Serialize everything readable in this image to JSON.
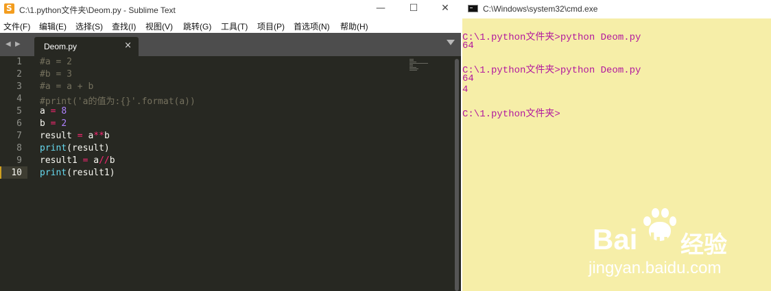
{
  "sublime": {
    "title": "C:\\1.python文件夹\\Deom.py - Sublime Text",
    "window_controls": {
      "minimize": "—",
      "maximize": "☐",
      "close": "✕"
    },
    "menu": [
      "文件(F)",
      "编辑(E)",
      "选择(S)",
      "查找(I)",
      "视图(V)",
      "跳转(G)",
      "工具(T)",
      "项目(P)",
      "首选项(N)",
      "帮助(H)"
    ],
    "tab": {
      "label": "Deom.py",
      "close": "×"
    },
    "nav": {
      "back": "◀",
      "forward": "▶"
    },
    "line_numbers": [
      "1",
      "2",
      "3",
      "4",
      "5",
      "6",
      "7",
      "8",
      "9",
      "10"
    ],
    "current_line": 10,
    "code": [
      [
        {
          "t": "#a = 2",
          "c": "cmt"
        }
      ],
      [
        {
          "t": "#b = 3",
          "c": "cmt"
        }
      ],
      [
        {
          "t": "#a = a + b",
          "c": "cmt"
        }
      ],
      [
        {
          "t": "#print('a的值为:{}'.format(a))",
          "c": "cmt"
        }
      ],
      [
        {
          "t": "a ",
          "c": ""
        },
        {
          "t": "=",
          "c": "kw"
        },
        {
          "t": " ",
          "c": ""
        },
        {
          "t": "8",
          "c": "num"
        }
      ],
      [
        {
          "t": "b ",
          "c": ""
        },
        {
          "t": "=",
          "c": "kw"
        },
        {
          "t": " ",
          "c": ""
        },
        {
          "t": "2",
          "c": "num"
        }
      ],
      [
        {
          "t": "result ",
          "c": ""
        },
        {
          "t": "=",
          "c": "kw"
        },
        {
          "t": " a",
          "c": ""
        },
        {
          "t": "**",
          "c": "kw"
        },
        {
          "t": "b",
          "c": ""
        }
      ],
      [
        {
          "t": "print",
          "c": "fn"
        },
        {
          "t": "(result)",
          "c": ""
        }
      ],
      [
        {
          "t": "result1 ",
          "c": ""
        },
        {
          "t": "=",
          "c": "kw"
        },
        {
          "t": " a",
          "c": ""
        },
        {
          "t": "//",
          "c": "kw"
        },
        {
          "t": "b",
          "c": ""
        }
      ],
      [
        {
          "t": "print",
          "c": "fn"
        },
        {
          "t": "(result1)",
          "c": ""
        }
      ]
    ]
  },
  "cmd": {
    "title": "C:\\Windows\\system32\\cmd.exe",
    "lines": [
      "C:\\1.python文件夹>python Deom.py",
      "64",
      "",
      "C:\\1.python文件夹>python Deom.py",
      "64",
      "4",
      "",
      "C:\\1.python文件夹>"
    ]
  },
  "watermark": {
    "brand_left": "Bai",
    "brand_right": "du",
    "brand_cn": "经验",
    "url": "jingyan.baidu.com"
  },
  "colors": {
    "editor_bg": "#272822",
    "keyword": "#f92672",
    "number": "#ae81ff",
    "function": "#66d9ef",
    "comment": "#75715e",
    "cmd_bg": "#f6eea8",
    "cmd_text": "#b2189e"
  }
}
